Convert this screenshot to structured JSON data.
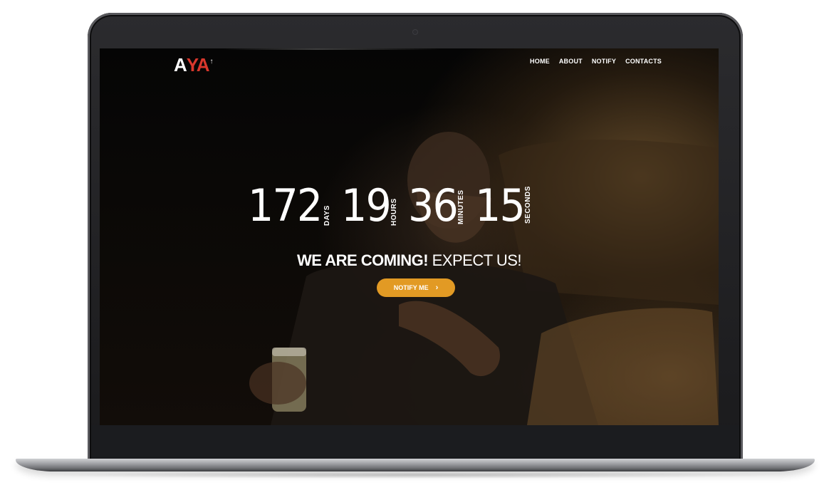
{
  "brand": {
    "logo_prefix": "A",
    "logo_accent": "YA",
    "logo_mark": "↑",
    "accent_color": "#d8372c"
  },
  "nav": {
    "items": [
      "HOME",
      "ABOUT",
      "NOTIFY",
      "CONTACTS"
    ]
  },
  "countdown": {
    "days": "172",
    "days_label": "DAYS",
    "hours": "19",
    "hours_label": "HOURS",
    "minutes": "36",
    "minutes_label": "MINUTES",
    "seconds": "15",
    "seconds_label": "SECONDS"
  },
  "headline": {
    "bold": "WE ARE COMING!",
    "regular": " EXPECT US!"
  },
  "cta": {
    "label": "NOTIFY ME",
    "icon": "chevron-right-icon",
    "color": "#e29a24"
  }
}
